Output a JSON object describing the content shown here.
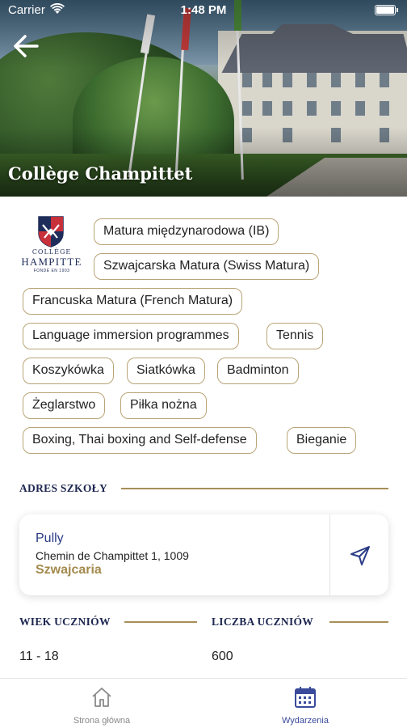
{
  "status_bar": {
    "carrier": "Carrier",
    "time": "1:48 PM"
  },
  "hero": {
    "title": "Collège Champittet"
  },
  "logo": {
    "line1": "COLLÈGE",
    "line2": "HAMPITTE",
    "line3": "FONDÉ EN 1903"
  },
  "tags": [
    "Matura międzynarodowa (IB)",
    "Szwajcarska Matura (Swiss Matura)",
    "Francuska Matura (French Matura)",
    "Language immersion programmes",
    "Tennis",
    "Koszykówka",
    "Siatkówka",
    "Badminton",
    "Żeglarstwo",
    "Piłka nożna",
    "Boxing, Thai boxing and Self-defense",
    "Bieganie"
  ],
  "address": {
    "heading": "ADRES SZKOŁY",
    "city": "Pully",
    "street": "Chemin de Champittet 1, 1009",
    "country": "Szwajcaria"
  },
  "stats": {
    "age_heading": "WIEK UCZNIÓW",
    "age_value": "11 - 18",
    "count_heading": "LICZBA UCZNIÓW",
    "count_value": "600"
  },
  "tab_bar": {
    "home_label": "Strona główna",
    "events_label": "Wydarzenia"
  },
  "colors": {
    "accent_gold": "#a88f58",
    "navy": "#1d2750",
    "active_tab": "#3a4a9a",
    "inactive_tab": "#8a8a8a"
  },
  "icons": {
    "back": "arrow-left-icon",
    "navigate": "navigation-arrow-icon",
    "home": "home-icon",
    "events": "calendar-icon",
    "wifi": "wifi-icon",
    "battery": "battery-icon",
    "crest": "school-crest-icon"
  }
}
